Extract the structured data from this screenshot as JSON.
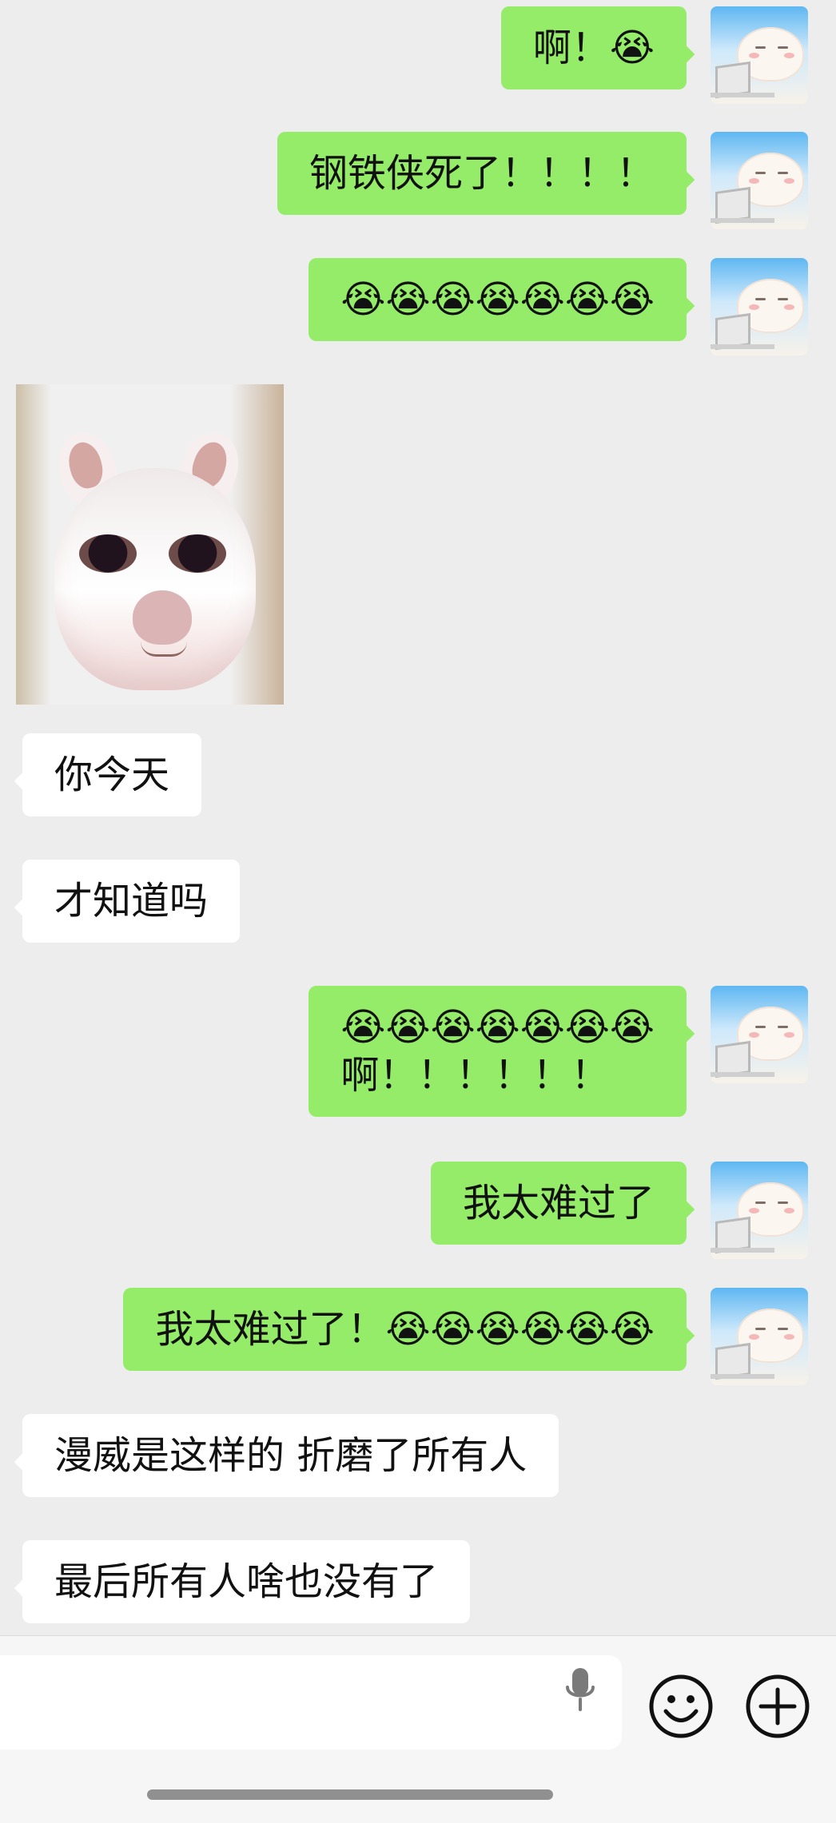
{
  "chat": {
    "messages": [
      {
        "sender": "self",
        "lines": [
          "啊！😭"
        ]
      },
      {
        "sender": "self",
        "lines": [
          "钢铁侠死了！！！！"
        ]
      },
      {
        "sender": "self",
        "lines": [
          "😭😭😭😭😭😭😭"
        ]
      },
      {
        "sender": "other",
        "type": "image",
        "image_desc": "cat photo"
      },
      {
        "sender": "other",
        "lines": [
          "你今天"
        ]
      },
      {
        "sender": "other",
        "lines": [
          "才知道吗"
        ]
      },
      {
        "sender": "self",
        "lines": [
          "😭😭😭😭😭😭😭",
          "啊！！！！！！"
        ]
      },
      {
        "sender": "self",
        "lines": [
          "我太难过了"
        ]
      },
      {
        "sender": "self",
        "lines": [
          "我太难过了！😭😭😭😭😭😭"
        ]
      },
      {
        "sender": "other",
        "lines": [
          "漫威是这样的 折磨了所有人"
        ]
      },
      {
        "sender": "other",
        "lines": [
          "最后所有人啥也没有了"
        ]
      }
    ]
  },
  "input_bar": {
    "placeholder": "",
    "icons": [
      "microphone-icon",
      "smile-emoji-icon",
      "plus-icon"
    ]
  },
  "theme": {
    "self_bubble": "#95ec69",
    "other_bubble": "#ffffff",
    "background": "#ededed"
  }
}
